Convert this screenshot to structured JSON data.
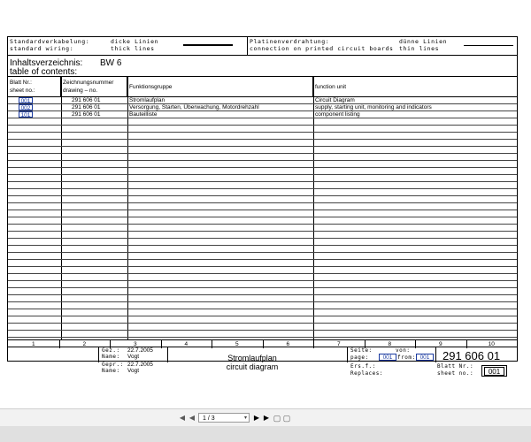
{
  "legend": {
    "std_de": "Standardverkabelung:",
    "std_en": "standard wiring:",
    "thick_de": "dicke Linien",
    "thick_en": "thick lines",
    "pcb_de": "Platinenverdrahtung:",
    "pcb_en": "connection on printed circuit boards",
    "thin_de": "dünne Linien",
    "thin_en": "thin lines"
  },
  "toc": {
    "title_de": "Inhaltsverzeichnis:",
    "title_code": "BW 6",
    "title_en": "table of contents:"
  },
  "headers": {
    "sheet_de": "Blatt Nr.:",
    "sheet_en": "sheet no.:",
    "drawing_de": "Zeichnungsnummer",
    "drawing_en": "drawing – no.",
    "group_de": "Funktionsgruppe",
    "unit_en": "function unit"
  },
  "rows": [
    {
      "sheet": "001",
      "drawing": "291 606 01",
      "group": "Stromlaufplan",
      "unit": "Circuit Diagram"
    },
    {
      "sheet": "002",
      "drawing": "291 606 01",
      "group": "Versorgung, Starten, Überwachung, Motordrehzahl",
      "unit": "supply, starting unit, monitoring and indicators"
    },
    {
      "sheet": "101",
      "drawing": "291 606 01",
      "group": "Bauteilliste",
      "unit": "component listing"
    }
  ],
  "col_numbers": [
    "1",
    "2",
    "3",
    "4",
    "5",
    "6",
    "7",
    "8",
    "9",
    "10"
  ],
  "titleblock": {
    "gez_label": "Gez.:",
    "gez_date": "22.7.2005",
    "name_label_1": "Name:",
    "name_1": "Vogt",
    "gepr_label": "Gepr.:",
    "gepr_date": "22.7.2005",
    "name_label_2": "Name:",
    "name_2": "Vogt",
    "title_de": "Stromlaufplan",
    "title_en": "circuit diagram",
    "seite_label": "Seite:",
    "von_label": "von:",
    "page_label": "page:",
    "page_value": "001",
    "from_label": "from:",
    "from_value": "001",
    "ers_label": "Ers.f.:",
    "replaces_label": "Replaces:",
    "drawing_number": "291 606 01",
    "blatt_label": "Blatt Nr.:",
    "sheet_label": "sheet no.:",
    "sheet_value": "001"
  },
  "toolbar": {
    "page_indicator": "1 / 3"
  }
}
